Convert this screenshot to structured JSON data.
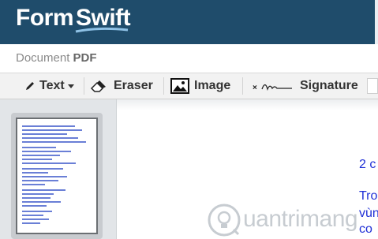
{
  "header": {
    "logo_part1": "Form",
    "logo_part2": "Swift",
    "brand_color": "#1f4c6b"
  },
  "document_bar": {
    "label": "Document",
    "type": "PDF"
  },
  "toolbar": {
    "text_label": "Text",
    "eraser_label": "Eraser",
    "image_label": "Image",
    "signature_label": "Signature",
    "icons": [
      "pencil-icon",
      "eraser-icon",
      "image-icon",
      "signature-icon",
      "chevron-down-icon"
    ]
  },
  "document": {
    "visible_text": [
      "2 c",
      "Tro",
      "vùn",
      "co"
    ],
    "text_color": "#1f2fd6"
  },
  "watermark": {
    "text": "uantrimang"
  }
}
